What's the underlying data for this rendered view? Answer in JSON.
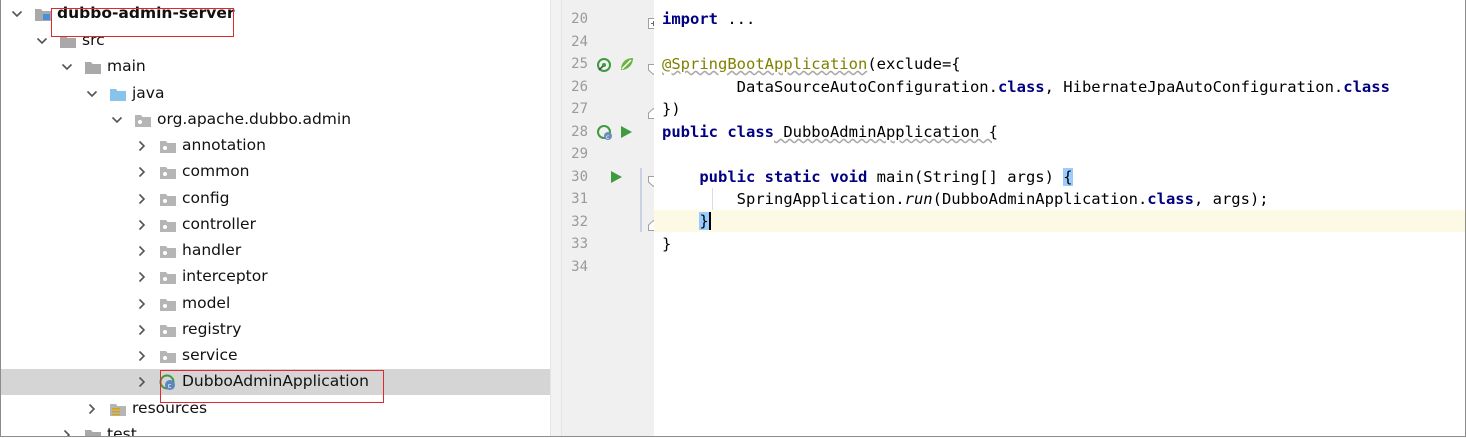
{
  "project_tree": {
    "items": [
      {
        "label": "dubbo-admin-server",
        "depth": 0,
        "expanded": true,
        "kind": "module",
        "bold": true
      },
      {
        "label": "src",
        "depth": 1,
        "expanded": true,
        "kind": "folder"
      },
      {
        "label": "main",
        "depth": 2,
        "expanded": true,
        "kind": "folder"
      },
      {
        "label": "java",
        "depth": 3,
        "expanded": true,
        "kind": "source-folder"
      },
      {
        "label": "org.apache.dubbo.admin",
        "depth": 4,
        "expanded": true,
        "kind": "package"
      },
      {
        "label": "annotation",
        "depth": 5,
        "expanded": false,
        "kind": "package"
      },
      {
        "label": "common",
        "depth": 5,
        "expanded": false,
        "kind": "package"
      },
      {
        "label": "config",
        "depth": 5,
        "expanded": false,
        "kind": "package"
      },
      {
        "label": "controller",
        "depth": 5,
        "expanded": false,
        "kind": "package"
      },
      {
        "label": "handler",
        "depth": 5,
        "expanded": false,
        "kind": "package"
      },
      {
        "label": "interceptor",
        "depth": 5,
        "expanded": false,
        "kind": "package"
      },
      {
        "label": "model",
        "depth": 5,
        "expanded": false,
        "kind": "package"
      },
      {
        "label": "registry",
        "depth": 5,
        "expanded": false,
        "kind": "package"
      },
      {
        "label": "service",
        "depth": 5,
        "expanded": false,
        "kind": "package"
      },
      {
        "label": "DubboAdminApplication",
        "depth": 5,
        "expanded": false,
        "kind": "spring-boot-class",
        "selected": true
      },
      {
        "label": "resources",
        "depth": 3,
        "expanded": false,
        "kind": "resources-folder"
      },
      {
        "label": "test",
        "depth": 2,
        "expanded": false,
        "kind": "folder",
        "partially_visible": true
      }
    ]
  },
  "editor": {
    "line_numbers": [
      "20",
      "24",
      "25",
      "26",
      "27",
      "28",
      "29",
      "30",
      "31",
      "32",
      "33",
      "34"
    ],
    "lines": {
      "l20": {
        "kw": "import",
        "rest": " ..."
      },
      "l25": {
        "ann": "@SpringBootApplication",
        "rest": "(exclude={"
      },
      "l26": {
        "a": "        DataSourceAutoConfiguration.",
        "kw1": "class",
        "b": ", HibernateJpaAutoConfiguration.",
        "kw2": "class"
      },
      "l27": {
        "text": "})"
      },
      "l28": {
        "kw": "public class",
        "rest": " DubboAdminApplication {"
      },
      "l30": {
        "indent": "    ",
        "kw": "public static void",
        "rest": " main(String[] args) ",
        "brace": "{"
      },
      "l31": {
        "a": "        SpringApplication.",
        "it": "run",
        "b": "(DubboAdminApplication.",
        "kw": "class",
        "c": ", args);"
      },
      "l32": {
        "indent": "    ",
        "brace": "}"
      },
      "l33": {
        "text": "}"
      }
    },
    "current_line": "32"
  },
  "colors": {
    "keyword": "#000080",
    "annotation": "#808000",
    "highlight_box": "#e0292d",
    "selection_row": "#d5d5d5",
    "caret_row": "#fcfae4",
    "brace_match": "#99ccff",
    "run_icon": "#3e9b3e"
  },
  "icons": {
    "module": "module-folder-icon",
    "folder": "folder-icon",
    "source_folder": "source-root-icon",
    "package": "package-icon",
    "spring_boot_class": "spring-boot-class-icon",
    "resources_folder": "resources-root-icon",
    "run": "run-gutter-icon",
    "spring_bean": "spring-bean-gutter-icon"
  }
}
